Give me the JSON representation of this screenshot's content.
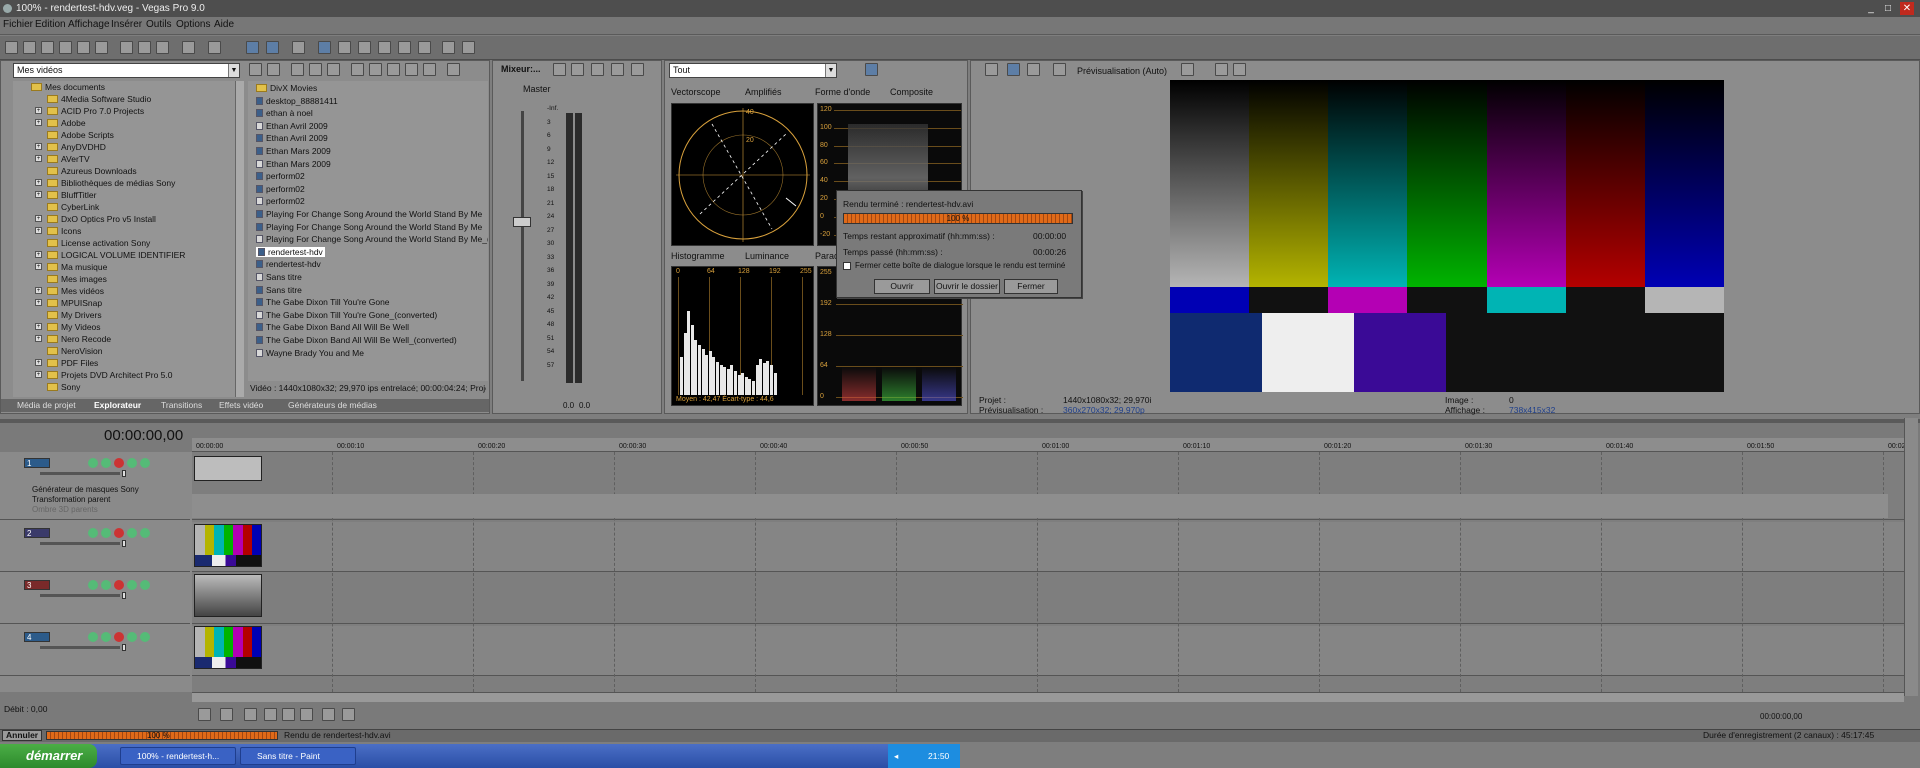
{
  "window": {
    "title": "100% - rendertest-hdv.veg - Vegas Pro 9.0"
  },
  "menu": [
    "Fichier",
    "Edition",
    "Affichage",
    "Insérer",
    "Outils",
    "Options",
    "Aide"
  ],
  "explorer": {
    "location": "Mes vidéos",
    "tree": [
      "Mes documents",
      "4Media Software Studio",
      "ACID Pro 7.0 Projects",
      "Adobe",
      "Adobe Scripts",
      "AnyDVDHD",
      "AVerTV",
      "Azureus Downloads",
      "Bibliothèques de médias Sony",
      "BluffTitler",
      "CyberLink",
      "DxO Optics Pro v5 Install",
      "Icons",
      "License activation Sony",
      "LOGICAL VOLUME IDENTIFIER",
      "Ma musique",
      "Mes images",
      "Mes vidéos",
      "MPUISnap",
      "My Drivers",
      "My Videos",
      "Nero Recode",
      "NeroVision",
      "PDF Files",
      "Projets DVD Architect Pro 5.0",
      "Sony"
    ],
    "files": [
      "DivX Movies",
      "desktop_88881411",
      "ethan à noel",
      "Ethan Avril 2009",
      "Ethan Avril 2009",
      "Ethan Mars 2009",
      "Ethan Mars 2009",
      "perform02",
      "perform02",
      "perform02",
      "Playing For Change Song Around the World  Stand By Me",
      "Playing For Change Song Around the World  Stand By Me",
      "Playing For Change Song Around the World  Stand By Me_(cc",
      "rendertest-hdv",
      "rendertest-hdv",
      "Sans titre",
      "Sans titre",
      "The Gabe Dixon  Till You're Gone",
      "The Gabe Dixon  Till You're Gone_(converted)",
      "The Gabe Dixon Band  All Will Be Well",
      "The Gabe Dixon Band  All Will Be Well_(converted)",
      "Wayne Brady  You and Me"
    ],
    "selected_file_index": 13,
    "info": "Vidéo : 1440x1080x32; 29,970 ips entrelacé; 00:00:04:24; Projet V",
    "tabs": [
      "Média de projet",
      "Explorateur",
      "Transitions",
      "Effets vidéo",
      "Générateurs de médias"
    ],
    "active_tab": 1
  },
  "mixer": {
    "title": "Mixeur:...",
    "master": "Master",
    "scale": [
      "-Inf.",
      "3",
      "6",
      "9",
      "12",
      "15",
      "18",
      "21",
      "24",
      "27",
      "30",
      "33",
      "36",
      "39",
      "42",
      "45",
      "48",
      "51",
      "54",
      "57"
    ],
    "levels": [
      "0.0",
      "0.0"
    ]
  },
  "scopes": {
    "selector": "Tout",
    "vectorscope_label": "Vectorscope",
    "vectorscope_mode": "Amplifiés",
    "waveform_label": "Forme d'onde",
    "waveform_mode": "Composite",
    "waveform_scale": [
      "120",
      "100",
      "80",
      "60",
      "40",
      "20",
      "0",
      "-20"
    ],
    "vector_marks": [
      "40",
      "20"
    ],
    "histogram_label": "Histogramme",
    "histogram_mode": "Luminance",
    "parade_label": "Parad",
    "histogram_ticks": [
      "0",
      "64",
      "128",
      "192",
      "255"
    ],
    "parade_scale": [
      "255",
      "192",
      "128",
      "64",
      "0"
    ],
    "histogram_stats": "Moyen : 42,47   Écart-type : 44,6"
  },
  "dialog": {
    "title": "Rendu terminé : rendertest-hdv.avi",
    "progress": "100 %",
    "progress_fraction": 1.0,
    "remaining_label": "Temps restant approximatif (hh:mm:ss) :",
    "remaining_value": "00:00:00",
    "elapsed_label": "Temps passé (hh:mm:ss) :",
    "elapsed_value": "00:00:26",
    "checkbox_label": "Fermer cette boîte de dialogue lorsque le rendu est terminé",
    "btn_open": "Ouvrir",
    "btn_open_folder": "Ouvrir le dossier",
    "btn_close": "Fermer"
  },
  "preview": {
    "mode": "Prévisualisation (Auto)",
    "project_label": "Projet :",
    "project_value": "1440x1080x32; 29,970i",
    "preview_label": "Prévisualisation :",
    "preview_value": "360x270x32; 29,970p",
    "frame_label": "Image :",
    "frame_value": "0",
    "display_label": "Affichage :",
    "display_value": "738x415x32",
    "colors": [
      "#b5b5b5",
      "#b4b400",
      "#00b4b4",
      "#00b400",
      "#b400b4",
      "#b40000",
      "#0000b4"
    ]
  },
  "timeline": {
    "timecode": "00:00:00,00",
    "ruler": [
      "00:00:00",
      "00:00:10",
      "00:00:20",
      "00:00:30",
      "00:00:40",
      "00:00:50",
      "00:01:00",
      "00:01:10",
      "00:01:20",
      "00:01:30",
      "00:01:40",
      "00:01:50",
      "00:02:0"
    ],
    "tracks": [
      "1",
      "2",
      "3",
      "4"
    ],
    "track1_fx": [
      "Générateur de masques Sony",
      "Transformation parent",
      "Ombre 3D parents"
    ],
    "rate": "Débit : 0,00",
    "end_time": "00:00:00,00"
  },
  "status": {
    "cancel": "Annuler",
    "percent": "100 %",
    "message": "Rendu de rendertest-hdv.avi",
    "record": "Durée d'enregistrement (2 canaux) : 45:17:45"
  },
  "taskbar": {
    "start": "démarrer",
    "tasks": [
      "100% - rendertest-h...",
      "Sans titre - Paint"
    ],
    "clock": "21:50"
  }
}
